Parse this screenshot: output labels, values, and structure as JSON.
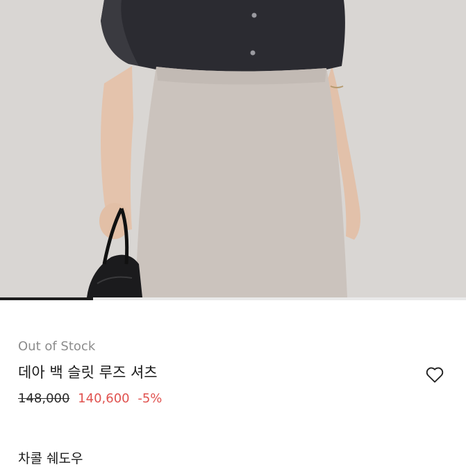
{
  "product": {
    "stock_status": "Out of Stock",
    "name": "데아 백 슬릿 루즈 셔츠",
    "original_price": "148,000",
    "sale_price": "140,600",
    "discount": "-5%",
    "variant": "차콜 쉐도우"
  },
  "gallery": {
    "progress": 0.2
  },
  "icons": {
    "wishlist": "heart-outline-icon"
  },
  "colors": {
    "sale": "#e0524f",
    "muted": "#8c8c8c",
    "text": "#1a1a1a"
  }
}
